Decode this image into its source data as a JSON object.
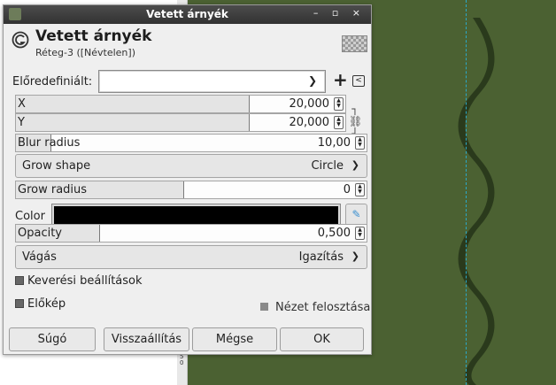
{
  "window": {
    "title": "Vetett árnyék"
  },
  "header": {
    "title": "Vetett árnyék",
    "subtitle": "Réteg-3 ([Névtelen])"
  },
  "presets": {
    "label": "Előredefiniált:",
    "value": ""
  },
  "fields": {
    "x": {
      "label": "X",
      "value": "20,000",
      "fill": 0.71
    },
    "y": {
      "label": "Y",
      "value": "20,000",
      "fill": 0.71
    },
    "blur_radius": {
      "label": "Blur radius",
      "value": "10,00",
      "fill": 0.1
    },
    "grow_shape": {
      "label": "Grow shape",
      "value": "Circle"
    },
    "grow_radius": {
      "label": "Grow radius",
      "value": "0",
      "fill": 0.48
    },
    "color": {
      "label": "Color",
      "value": "#000000"
    },
    "opacity": {
      "label": "Opacity",
      "value": "0,500",
      "fill": 0.24
    },
    "clipping": {
      "label": "Vágás",
      "value": "Igazítás"
    }
  },
  "blending_expander": {
    "label": "Keverési beállítások"
  },
  "preview": {
    "label": "Előkép"
  },
  "split_view": {
    "label": "Nézet felosztása"
  },
  "buttons": {
    "help": "Súgó",
    "reset": "Visszaállítás",
    "cancel": "Mégse",
    "ok": "OK"
  },
  "ruler": {
    "marks": "7 5 0"
  },
  "colors": {
    "canvas": "#4b6132",
    "wave": "#2a3a1c",
    "guide": "#2aa9c9"
  },
  "icons": [
    "gimp-icon",
    "chevron-down-icon",
    "plus-icon",
    "menu-icon",
    "chain-icon",
    "spinner-arrows-icon",
    "eyedropper-icon",
    "expander-icon",
    "checkbox-icon"
  ]
}
